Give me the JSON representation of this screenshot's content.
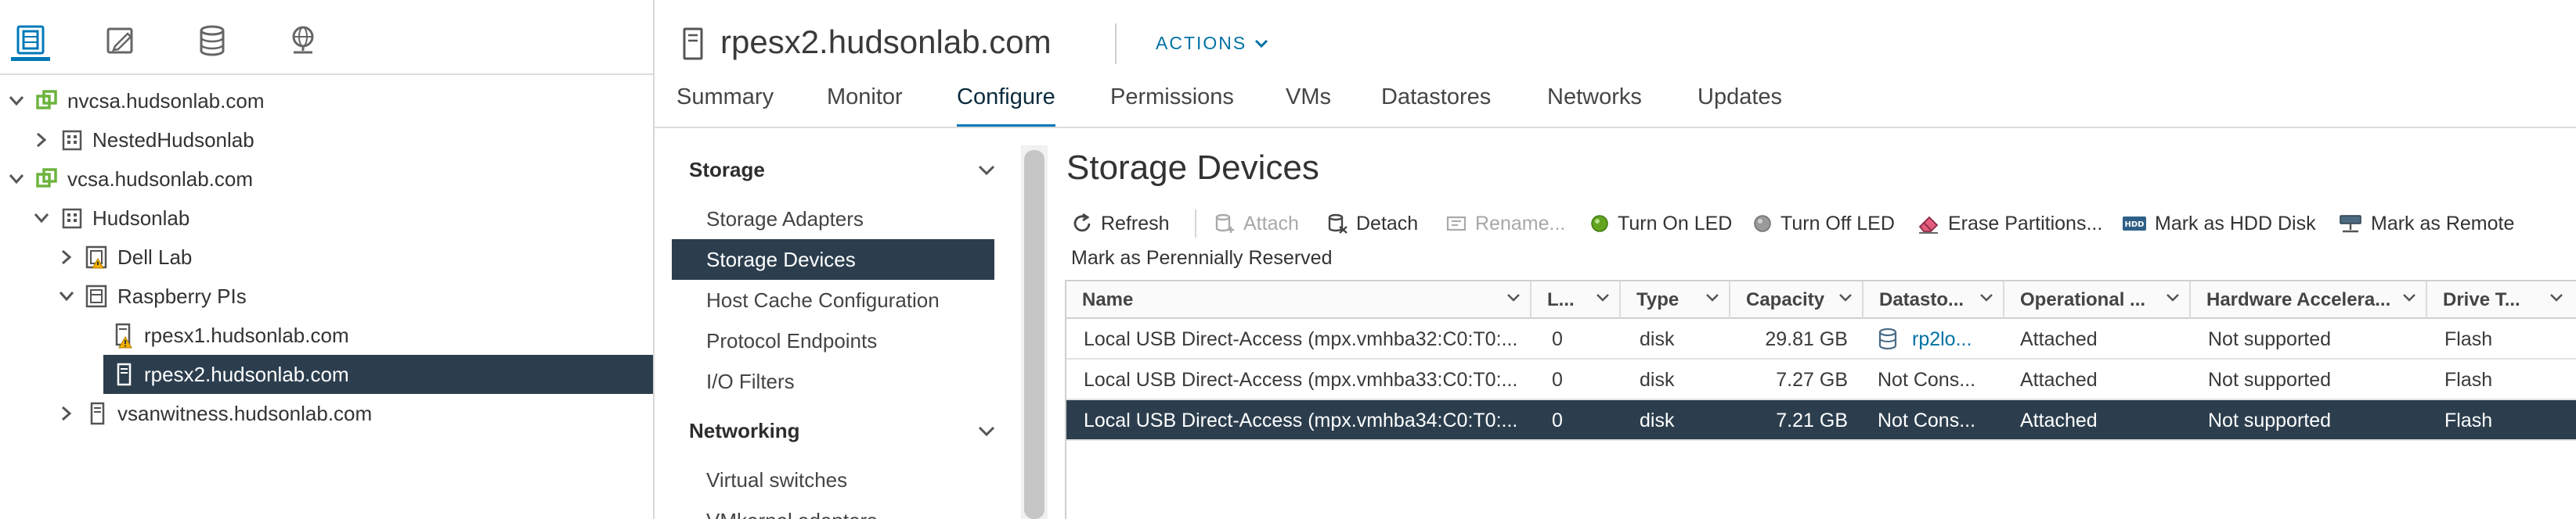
{
  "navigator": {
    "tabs": [
      {
        "icon": "hosts-clusters-icon"
      },
      {
        "icon": "vms-templates-icon"
      },
      {
        "icon": "storage-icon"
      },
      {
        "icon": "networking-icon"
      }
    ],
    "tree": [
      {
        "label": "nvcsa.hudsonlab.com",
        "icon": "vcenter-icon",
        "state": "expanded"
      },
      {
        "label": "NestedHudsonlab",
        "icon": "datacenter-icon",
        "state": "collapsed"
      },
      {
        "label": "vcsa.hudsonlab.com",
        "icon": "vcenter-icon",
        "state": "expanded"
      },
      {
        "label": "Hudsonlab",
        "icon": "datacenter-icon",
        "state": "expanded"
      },
      {
        "label": "Dell Lab",
        "icon": "cluster-warning-icon",
        "state": "collapsed"
      },
      {
        "label": "Raspberry PIs",
        "icon": "cluster-icon",
        "state": "expanded"
      },
      {
        "label": "rpesx1.hudsonlab.com",
        "icon": "host-warning-icon",
        "state": "leaf"
      },
      {
        "label": "rpesx2.hudsonlab.com",
        "icon": "host-icon",
        "state": "leaf",
        "selected": true
      },
      {
        "label": "vsanwitness.hudsonlab.com",
        "icon": "host-icon",
        "state": "collapsed"
      }
    ]
  },
  "header": {
    "title": "rpesx2.hudsonlab.com",
    "actions_label": "ACTIONS"
  },
  "tabs": [
    {
      "label": "Summary"
    },
    {
      "label": "Monitor"
    },
    {
      "label": "Configure",
      "active": true
    },
    {
      "label": "Permissions"
    },
    {
      "label": "VMs"
    },
    {
      "label": "Datastores"
    },
    {
      "label": "Networks"
    },
    {
      "label": "Updates"
    }
  ],
  "configure_nav": {
    "sections": [
      {
        "title": "Storage",
        "items": [
          "Storage Adapters",
          "Storage Devices",
          "Host Cache Configuration",
          "Protocol Endpoints",
          "I/O Filters"
        ]
      },
      {
        "title": "Networking",
        "items": [
          "Virtual switches",
          "VMkernel adapters"
        ]
      }
    ],
    "selected": "Storage Devices"
  },
  "content": {
    "title": "Storage Devices",
    "toolbar": {
      "refresh": "Refresh",
      "attach": "Attach",
      "detach": "Detach",
      "rename": "Rename...",
      "turn_on_led": "Turn On LED",
      "turn_off_led": "Turn Off LED",
      "erase_partitions": "Erase Partitions...",
      "mark_hdd": "Mark as HDD Disk",
      "mark_remote": "Mark as Remote",
      "mark_perennial": "Mark as Perennially Reserved"
    },
    "columns": [
      "Name",
      "L...",
      "Type",
      "Capacity",
      "Datasto...",
      "Operational ...",
      "Hardware Accelera...",
      "Drive T..."
    ],
    "rows": [
      {
        "name": "Local USB Direct-Access (mpx.vmhba32:C0:T0:...",
        "lun": "0",
        "type": "disk",
        "capacity": "29.81 GB",
        "datastore": "rp2lo...",
        "operational": "Attached",
        "hw_accel": "Not supported",
        "drive_type": "Flash"
      },
      {
        "name": "Local USB Direct-Access (mpx.vmhba33:C0:T0:...",
        "lun": "0",
        "type": "disk",
        "capacity": "7.27 GB",
        "datastore": "Not Cons...",
        "operational": "Attached",
        "hw_accel": "Not supported",
        "drive_type": "Flash"
      },
      {
        "name": "Local USB Direct-Access (mpx.vmhba34:C0:T0:...",
        "lun": "0",
        "type": "disk",
        "capacity": "7.21 GB",
        "datastore": "Not Cons...",
        "operational": "Attached",
        "hw_accel": "Not supported",
        "drive_type": "Flash",
        "selected": true
      }
    ]
  },
  "colors": {
    "accent": "#0079b8",
    "link": "#0072a3",
    "selected_bg": "#2c3e4e",
    "led_on": "#62a420",
    "led_off": "#9a9a9a",
    "vcenter": "#6db33f",
    "warning": "#f0b000"
  }
}
